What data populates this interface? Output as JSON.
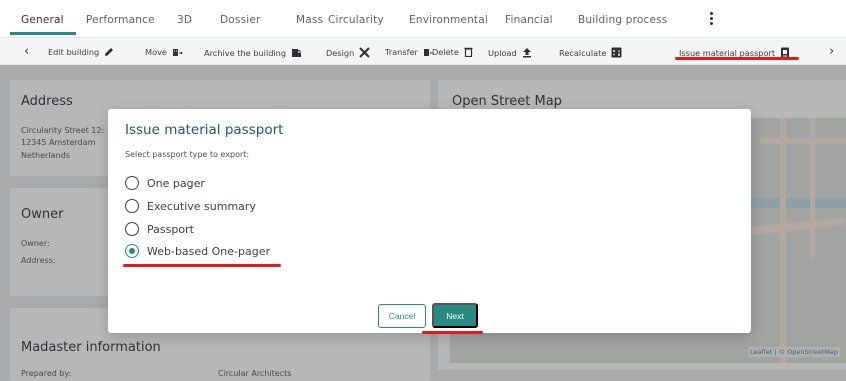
{
  "tabs": [
    {
      "label": "General"
    },
    {
      "label": "Performance"
    },
    {
      "label": "3D"
    },
    {
      "label": "Dossier"
    },
    {
      "label": "Mass"
    },
    {
      "label": "Circularity"
    },
    {
      "label": "Environmental"
    },
    {
      "label": "Financial"
    },
    {
      "label": "Building process"
    }
  ],
  "toolbar": {
    "items": [
      {
        "label": "Edit building",
        "icon": "pencil-icon"
      },
      {
        "label": "Move",
        "icon": "move-building-icon"
      },
      {
        "label": "Archive the building",
        "icon": "archive-lock-icon"
      },
      {
        "label": "Design",
        "icon": "design-tools-icon"
      },
      {
        "label": "Transfer",
        "icon": "transfer-building-icon"
      },
      {
        "label": "Delete",
        "icon": "trash-icon"
      },
      {
        "label": "Upload",
        "icon": "upload-icon"
      },
      {
        "label": "Recalculate",
        "icon": "calculator-icon"
      },
      {
        "label": "Issue material passport",
        "icon": "passport-icon"
      }
    ]
  },
  "background": {
    "address": {
      "title": "Address",
      "lines": [
        "Circularity Street 12:",
        "12345 Amsterdam",
        "Netherlands"
      ]
    },
    "owner": {
      "title": "Owner",
      "owner_label": "Owner:",
      "address_label": "Address:"
    },
    "madaster": {
      "title": "Madaster information",
      "prepared_by_label": "Prepared by:",
      "prepared_by_value": "Circular Architects"
    },
    "map": {
      "title": "Open Street Map",
      "attribution": "Leaflet | © OpenStreetMap"
    }
  },
  "dialog": {
    "title": "Issue material passport",
    "subtitle": "Select passport type to export:",
    "options": [
      {
        "label": "One pager",
        "selected": false
      },
      {
        "label": "Executive summary",
        "selected": false
      },
      {
        "label": "Passport",
        "selected": false
      },
      {
        "label": "Web-based One-pager",
        "selected": true
      }
    ],
    "cancel_label": "Cancel",
    "next_label": "Next"
  },
  "colors": {
    "accent": "#2a8a83",
    "title": "#24566b",
    "highlight": "#e01b1b"
  }
}
